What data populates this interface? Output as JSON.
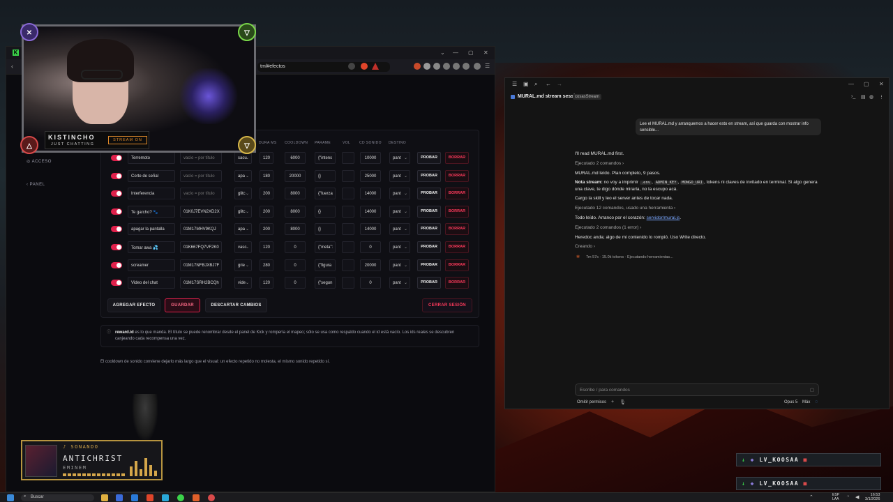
{
  "browser": {
    "url": "tml#efectos",
    "sidebar": {
      "acceso": "ACCESO",
      "panel": "PANEL"
    }
  },
  "table": {
    "headers": {
      "dura": "DURA MS",
      "cooldown": "COOLDOWN",
      "params": "PARAME",
      "vol": "VOL",
      "cd_sonido": "CD SONIDO",
      "destino": "DESTINO"
    },
    "rows": [
      {
        "name": "Terremoto",
        "reward_id": "vacío = por título",
        "tipo": "sacu",
        "dur": "120",
        "cooldown": "6000",
        "params": "{\"intens",
        "cd": "10000",
        "dest": "pant"
      },
      {
        "name": "Corte de señal",
        "reward_id": "vacío = por título",
        "tipo": "apa",
        "dur": "180",
        "cooldown": "20000",
        "params": "{}",
        "cd": "25000",
        "dest": "pant"
      },
      {
        "name": "Interferencia",
        "reward_id": "vacío = por título",
        "tipo": "glitc",
        "dur": "200",
        "cooldown": "8000",
        "params": "{\"fuerza",
        "cd": "14000",
        "dest": "pant"
      },
      {
        "name": "Te garcho? 🐾",
        "reward_id": "01K0J7EVN2XD2X",
        "tipo": "glitc",
        "dur": "200",
        "cooldown": "8000",
        "params": "{}",
        "cd": "14000",
        "dest": "pant"
      },
      {
        "name": "apagar la pantalla",
        "reward_id": "01M17MHV9KQJ",
        "tipo": "apa",
        "dur": "200",
        "cooldown": "8000",
        "params": "{}",
        "cd": "14000",
        "dest": "pant"
      },
      {
        "name": "Tomar awa 💦",
        "reward_id": "01K667FQ7VF2K0",
        "tipo": "vasc",
        "dur": "120",
        "cooldown": "0",
        "params": "{\"meta\":",
        "cd": "0",
        "dest": "pant"
      },
      {
        "name": "screamer",
        "reward_id": "01M17NFBJXBJ7F",
        "tipo": "grie",
        "dur": "280",
        "cooldown": "0",
        "params": "{\"figura",
        "cd": "20000",
        "dest": "pant"
      },
      {
        "name": "Video del chat",
        "reward_id": "01M17SRH2BCQh",
        "tipo": "vide",
        "dur": "120",
        "cooldown": "0",
        "params": "{\"segun",
        "cd": "0",
        "dest": "pant"
      }
    ],
    "probar": "PROBAR",
    "borrar": "BORRAR"
  },
  "actions": {
    "agregar": "AGREGAR EFECTO",
    "guardar": "GUARDAR",
    "descartar": "DESCARTAR CAMBIOS",
    "cerrar": "CERRAR SESIÓN"
  },
  "notes": {
    "reward_bold": "reward.id",
    "reward_text": " es lo que manda. El título se puede renombrar desde el panel de Kick y rompería el mapeo; sólo se usa como respaldo cuando el id está vacío. Los ids reales se descubren canjeando cada recompensa una vez.",
    "cooldown": "El cooldown de sonido conviene dejarlo más largo que el visual: un efecto repetido no molesta, el mismo sonido repetido sí."
  },
  "overlay": {
    "brand_name": "KISTINCHO",
    "brand_sub": "JUST CHATTING",
    "stream_on": "STREAM ON",
    "np_status": "♪ SONANDO",
    "np_title": "ANTICHRIST",
    "np_artist": "EMINEM"
  },
  "claude": {
    "title": "MURAL.md stream session",
    "tag": "cosasStream",
    "user_msg": "Lee el MURAL.md y arranquemos a hacer esto en stream, así que guarda con mostrar info sensible...",
    "m1": "I'll read MURAL.md first.",
    "m2": "Ejecutado 2 comandos ›",
    "m3": "MURAL.md leído. Plan completo, 9 pasos.",
    "m4_bold": "Nota stream:",
    "m4_a": " no voy a imprimir ",
    "m4_code1": ".env",
    "m4_code2": "ADMIN_KEY",
    "m4_code3": "MONGO_URI",
    "m4_b": ", tokens ni claves de invitado en terminal. Si algo genera una clave, te digo dónde mirarla, no la escupo acá.",
    "m5": "Cargo la skill y leo el server antes de tocar nada.",
    "m6": "Ejecutado 12 comandos, usado una herramienta ›",
    "m7_a": "Todo leído. Arranco por el corazón: ",
    "m7_link": "servidor/mural.js",
    "m7_b": ".",
    "m8": "Ejecutado 2 comandos (1 error) ›",
    "m9": "Heredoc anda; algo de mi contenido lo rompió. Uso Write directo.",
    "m10": "Creando ›",
    "status": "7m 57s · 15.0k tokens · Ejecutando herramientas...",
    "composer_placeholder": "Escribe / para comandos",
    "omit": "Omitir permisos",
    "model": "Opus 5",
    "effort": "Máx"
  },
  "chat": {
    "user": "LV_KOOSAA"
  },
  "taskbar": {
    "search": "Buscar",
    "lang": "ESP",
    "lang2": "LAA",
    "time": "16:53",
    "date": "3/1/2026"
  }
}
